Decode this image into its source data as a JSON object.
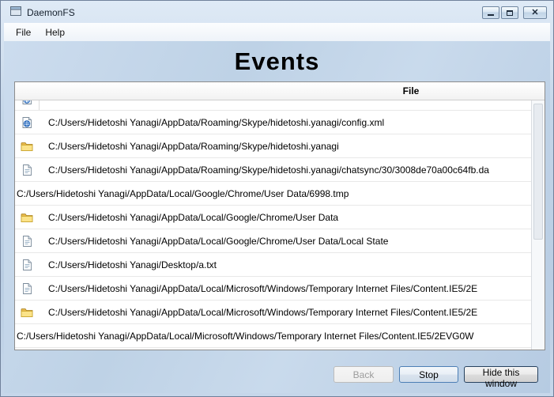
{
  "window": {
    "title": "DaemonFS",
    "close_glyph": "✕"
  },
  "menu": {
    "items": [
      {
        "label": "File"
      },
      {
        "label": "Help"
      }
    ]
  },
  "heading": "Events",
  "table": {
    "header": "File",
    "rows": [
      {
        "icon": "partial",
        "text": ""
      },
      {
        "icon": "xml",
        "text": "C:/Users/Hidetoshi Yanagi/AppData/Roaming/Skype/hidetoshi.yanagi/config.xml"
      },
      {
        "icon": "folder",
        "text": "C:/Users/Hidetoshi Yanagi/AppData/Roaming/Skype/hidetoshi.yanagi"
      },
      {
        "icon": "file",
        "text": "C:/Users/Hidetoshi Yanagi/AppData/Roaming/Skype/hidetoshi.yanagi/chatsync/30/3008de70a00c64fb.da"
      },
      {
        "icon": "none",
        "text": "C:/Users/Hidetoshi Yanagi/AppData/Local/Google/Chrome/User Data/6998.tmp"
      },
      {
        "icon": "folder",
        "text": "C:/Users/Hidetoshi Yanagi/AppData/Local/Google/Chrome/User Data"
      },
      {
        "icon": "file",
        "text": "C:/Users/Hidetoshi Yanagi/AppData/Local/Google/Chrome/User Data/Local State"
      },
      {
        "icon": "file",
        "text": "C:/Users/Hidetoshi Yanagi/Desktop/a.txt"
      },
      {
        "icon": "file",
        "text": "C:/Users/Hidetoshi Yanagi/AppData/Local/Microsoft/Windows/Temporary Internet Files/Content.IE5/2E"
      },
      {
        "icon": "folder",
        "text": "C:/Users/Hidetoshi Yanagi/AppData/Local/Microsoft/Windows/Temporary Internet Files/Content.IE5/2E"
      },
      {
        "icon": "none",
        "text": "C:/Users/Hidetoshi Yanagi/AppData/Local/Microsoft/Windows/Temporary Internet Files/Content.IE5/2EVG0W"
      }
    ]
  },
  "buttons": {
    "back": "Back",
    "stop": "Stop",
    "hide": "Hide this window"
  },
  "colors": {
    "frame": "#b9cde3",
    "title_text": "#16212e",
    "folder_icon": "#f3c64a",
    "globe_icon": "#1e62b8",
    "stop_border": "#4d7fb5",
    "hide_border": "#27425f"
  }
}
